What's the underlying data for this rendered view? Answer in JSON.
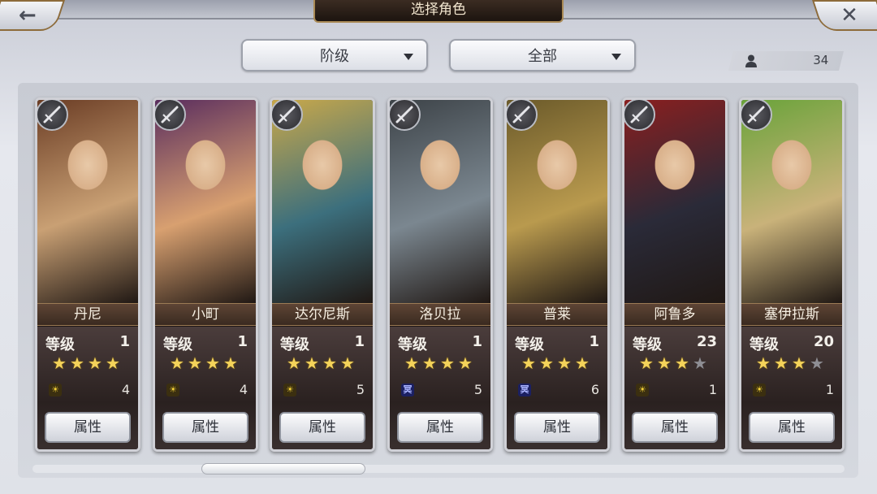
{
  "header": {
    "title": "选择角色",
    "back_glyph": "←",
    "close_glyph": "✕"
  },
  "filters": {
    "rank": {
      "selected": "阶级"
    },
    "category": {
      "selected": "全部"
    }
  },
  "roster": {
    "count": "34"
  },
  "characters": [
    {
      "name": "丹尼",
      "level_label": "等级",
      "level": "1",
      "stars": 4,
      "max_stars": 4,
      "element": "sun",
      "element_glyph": "☀",
      "element_count": "4",
      "button": "属性",
      "colors": [
        "#6b3d25",
        "#c9a074"
      ]
    },
    {
      "name": "小町",
      "level_label": "等级",
      "level": "1",
      "stars": 4,
      "max_stars": 4,
      "element": "sun",
      "element_glyph": "☀",
      "element_count": "4",
      "button": "属性",
      "colors": [
        "#5a2d5e",
        "#d8a070"
      ]
    },
    {
      "name": "达尔尼斯",
      "level_label": "等级",
      "level": "1",
      "stars": 4,
      "max_stars": 4,
      "element": "sun",
      "element_glyph": "☀",
      "element_count": "5",
      "button": "属性",
      "colors": [
        "#c9a84a",
        "#3c6f7d"
      ]
    },
    {
      "name": "洛贝拉",
      "level_label": "等级",
      "level": "1",
      "stars": 4,
      "max_stars": 4,
      "element": "dark",
      "element_glyph": "冥",
      "element_count": "5",
      "button": "属性",
      "colors": [
        "#3d4348",
        "#7b8790"
      ]
    },
    {
      "name": "普莱",
      "level_label": "等级",
      "level": "1",
      "stars": 4,
      "max_stars": 4,
      "element": "dark",
      "element_glyph": "冥",
      "element_count": "6",
      "button": "属性",
      "colors": [
        "#6b5a2a",
        "#b99a4e"
      ]
    },
    {
      "name": "阿鲁多",
      "level_label": "等级",
      "level": "23",
      "stars": 3,
      "max_stars": 4,
      "element": "sun",
      "element_glyph": "☀",
      "element_count": "1",
      "button": "属性",
      "colors": [
        "#8a1f1f",
        "#2a2a38"
      ]
    },
    {
      "name": "塞伊拉斯",
      "level_label": "等级",
      "level": "20",
      "stars": 3,
      "max_stars": 4,
      "element": "sun",
      "element_glyph": "☀",
      "element_count": "1",
      "button": "属性",
      "colors": [
        "#6aa33a",
        "#c9b27a"
      ]
    }
  ]
}
